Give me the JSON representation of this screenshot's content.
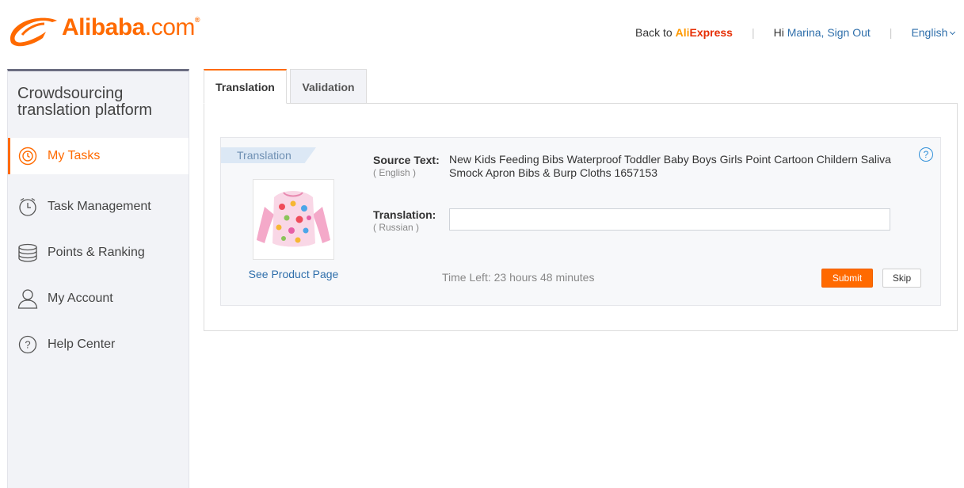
{
  "brand": {
    "name": "Alibaba",
    "tld": ".com",
    "registered": "®",
    "color": "#ff6a00"
  },
  "topnav": {
    "back_prefix": "Back to ",
    "aliexpress_a": "Ali",
    "aliexpress_b": "Express",
    "greeting": "Hi ",
    "user_name": "Marina",
    "comma": ",",
    "sign_out": "Sign Out",
    "separator": "|",
    "language": "English"
  },
  "sidebar": {
    "title": "Crowdsourcing translation platform",
    "items": [
      {
        "label": "My Tasks",
        "icon": "tasks-icon",
        "active": true
      },
      {
        "label": "Task Management",
        "icon": "clock-icon",
        "active": false
      },
      {
        "label": "Points & Ranking",
        "icon": "coins-icon",
        "active": false
      },
      {
        "label": "My Account",
        "icon": "user-icon",
        "active": false
      },
      {
        "label": "Help Center",
        "icon": "help-icon",
        "active": false
      }
    ]
  },
  "tabs": [
    {
      "label": "Translation",
      "active": true
    },
    {
      "label": "Validation",
      "active": false
    }
  ],
  "task": {
    "ribbon": "Translation",
    "product_link": "See Product Page",
    "source_label": "Source Text:",
    "source_lang": "( English )",
    "source_text": "New Kids Feeding Bibs Waterproof Toddler Baby Boys Girls Point Cartoon Childern Saliva Smock Apron Bibs & Burp Cloths 1657153",
    "translation_label": "Translation:",
    "translation_lang": "( Russian )",
    "translation_value": "",
    "help_glyph": "?",
    "time_left": "Time Left: 23 hours 48 minutes",
    "submit_label": "Submit",
    "skip_label": "Skip"
  },
  "colors": {
    "accent": "#ff6a00",
    "link": "#2f6fab",
    "sidebar_bg": "#f2f3f7"
  }
}
